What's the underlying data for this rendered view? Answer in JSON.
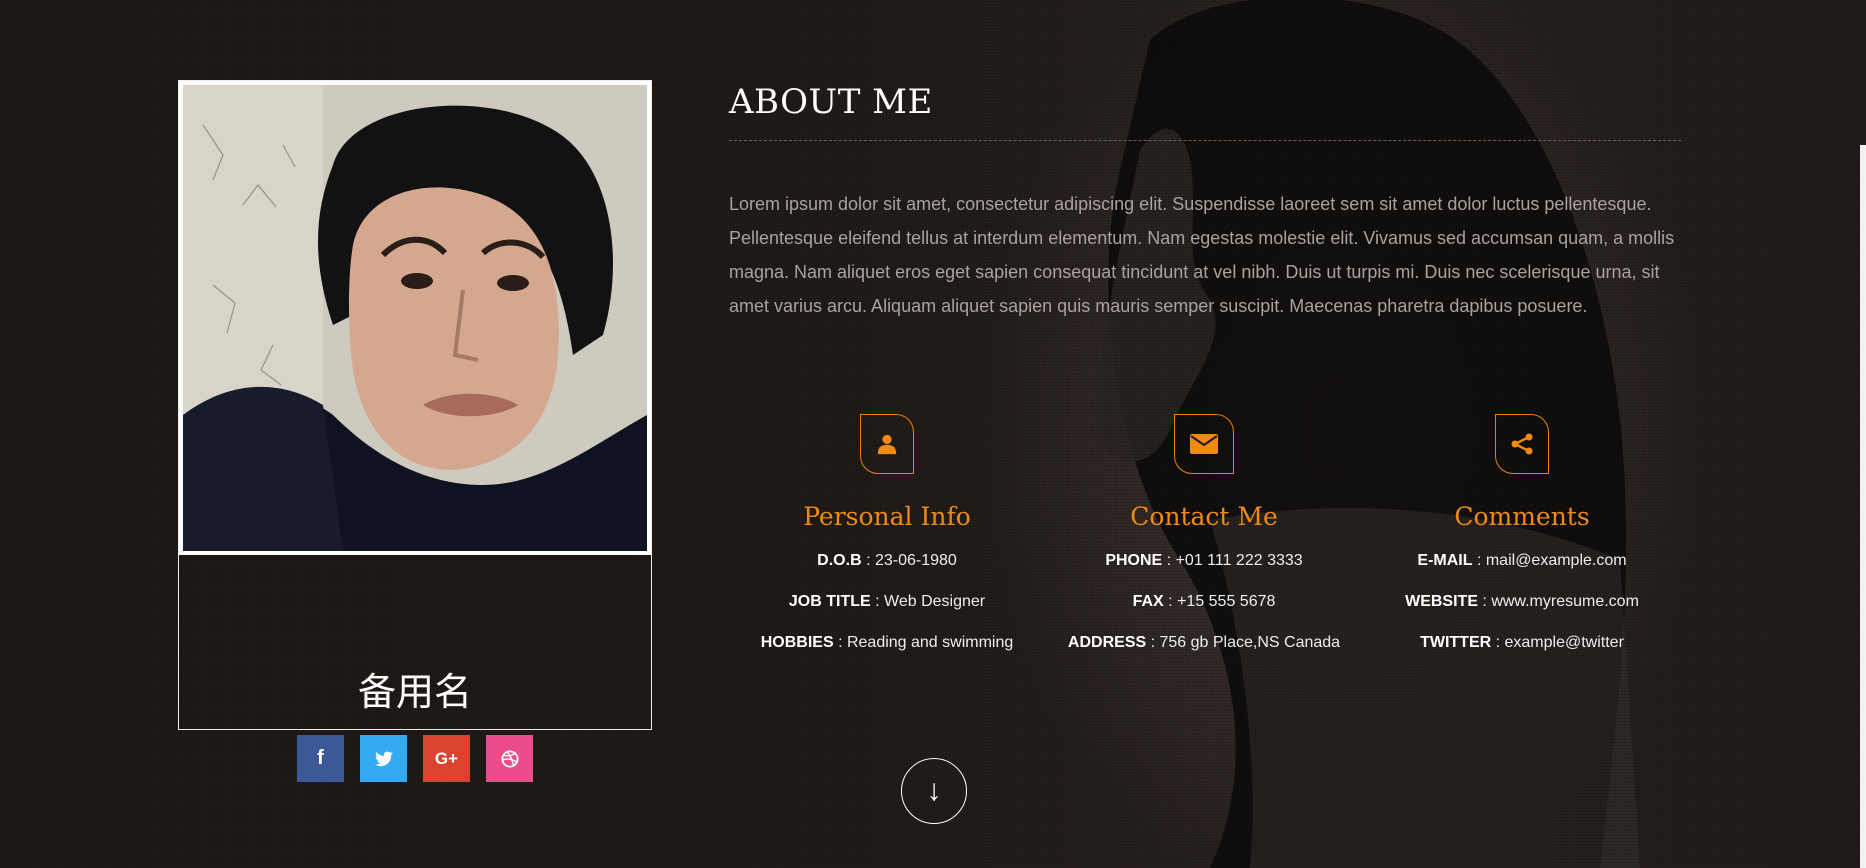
{
  "profile": {
    "name": "备用名",
    "social": [
      {
        "icon": "facebook-icon",
        "glyph": "f",
        "color": "#3b5998"
      },
      {
        "icon": "twitter-icon",
        "glyph": "t",
        "color": "#33aaf3"
      },
      {
        "icon": "google-plus-icon",
        "glyph": "G+",
        "color": "#d9432f"
      },
      {
        "icon": "dribbble-icon",
        "glyph": "◎",
        "color": "#ea4c89"
      }
    ]
  },
  "about": {
    "title": "ABOUT ME",
    "text": "Lorem ipsum dolor sit amet, consectetur adipiscing elit. Suspendisse laoreet sem sit amet dolor luctus pellentesque. Pellentesque eleifend tellus at interdum elementum. Nam egestas molestie elit. Vivamus sed accumsan quam, a mollis magna. Nam aliquet eros eget sapien consequat tincidunt at vel nibh. Duis ut turpis mi. Duis nec scelerisque urna, sit amet varius arcu. Aliquam aliquet sapien quis mauris semper suscipit. Maecenas pharetra dapibus posuere."
  },
  "columns": [
    {
      "icon": "user-icon",
      "heading": "Personal Info",
      "rows": [
        {
          "label": "D.O.B",
          "value": " : 23-06-1980"
        },
        {
          "label": "JOB TITLE",
          "value": " : Web Designer"
        },
        {
          "label": "HOBBIES",
          "value": " : Reading and swimming"
        }
      ]
    },
    {
      "icon": "envelope-icon",
      "heading": "Contact Me",
      "rows": [
        {
          "label": "PHONE",
          "value": " : +01 111 222 3333"
        },
        {
          "label": "FAX",
          "value": " : +15 555 5678"
        },
        {
          "label": "ADDRESS",
          "value": " : 756 gb Place,NS Canada"
        }
      ]
    },
    {
      "icon": "share-icon",
      "heading": "Comments",
      "rows": [
        {
          "label": "E-MAIL",
          "value": " : mail@example.com"
        },
        {
          "label": "WEBSITE",
          "value": " : www.myresume.com"
        },
        {
          "label": "TWITTER",
          "value": " : example@twitter"
        }
      ]
    }
  ],
  "scroll_down": {
    "icon": "arrow-down-icon",
    "glyph": "↓"
  },
  "colors": {
    "accent": "#f08a12",
    "background": "#221c18"
  }
}
